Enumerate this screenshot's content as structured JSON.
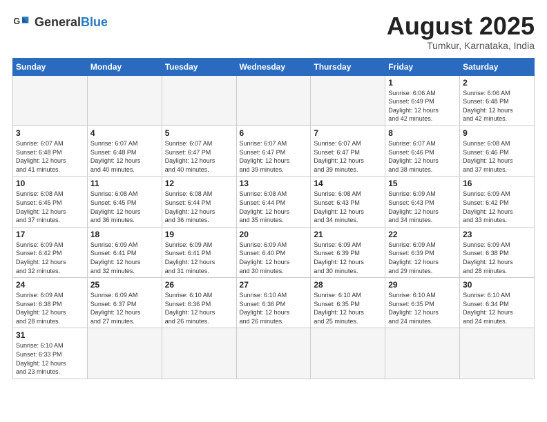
{
  "header": {
    "logo_general": "General",
    "logo_blue": "Blue",
    "title": "August 2025",
    "subtitle": "Tumkur, Karnataka, India"
  },
  "weekdays": [
    "Sunday",
    "Monday",
    "Tuesday",
    "Wednesday",
    "Thursday",
    "Friday",
    "Saturday"
  ],
  "weeks": [
    [
      {
        "day": "",
        "info": "",
        "empty": true
      },
      {
        "day": "",
        "info": "",
        "empty": true
      },
      {
        "day": "",
        "info": "",
        "empty": true
      },
      {
        "day": "",
        "info": "",
        "empty": true
      },
      {
        "day": "",
        "info": "",
        "empty": true
      },
      {
        "day": "1",
        "info": "Sunrise: 6:06 AM\nSunset: 6:49 PM\nDaylight: 12 hours\nand 42 minutes."
      },
      {
        "day": "2",
        "info": "Sunrise: 6:06 AM\nSunset: 6:48 PM\nDaylight: 12 hours\nand 42 minutes."
      }
    ],
    [
      {
        "day": "3",
        "info": "Sunrise: 6:07 AM\nSunset: 6:48 PM\nDaylight: 12 hours\nand 41 minutes."
      },
      {
        "day": "4",
        "info": "Sunrise: 6:07 AM\nSunset: 6:48 PM\nDaylight: 12 hours\nand 40 minutes."
      },
      {
        "day": "5",
        "info": "Sunrise: 6:07 AM\nSunset: 6:47 PM\nDaylight: 12 hours\nand 40 minutes."
      },
      {
        "day": "6",
        "info": "Sunrise: 6:07 AM\nSunset: 6:47 PM\nDaylight: 12 hours\nand 39 minutes."
      },
      {
        "day": "7",
        "info": "Sunrise: 6:07 AM\nSunset: 6:47 PM\nDaylight: 12 hours\nand 39 minutes."
      },
      {
        "day": "8",
        "info": "Sunrise: 6:07 AM\nSunset: 6:46 PM\nDaylight: 12 hours\nand 38 minutes."
      },
      {
        "day": "9",
        "info": "Sunrise: 6:08 AM\nSunset: 6:46 PM\nDaylight: 12 hours\nand 37 minutes."
      }
    ],
    [
      {
        "day": "10",
        "info": "Sunrise: 6:08 AM\nSunset: 6:45 PM\nDaylight: 12 hours\nand 37 minutes."
      },
      {
        "day": "11",
        "info": "Sunrise: 6:08 AM\nSunset: 6:45 PM\nDaylight: 12 hours\nand 36 minutes."
      },
      {
        "day": "12",
        "info": "Sunrise: 6:08 AM\nSunset: 6:44 PM\nDaylight: 12 hours\nand 36 minutes."
      },
      {
        "day": "13",
        "info": "Sunrise: 6:08 AM\nSunset: 6:44 PM\nDaylight: 12 hours\nand 35 minutes."
      },
      {
        "day": "14",
        "info": "Sunrise: 6:08 AM\nSunset: 6:43 PM\nDaylight: 12 hours\nand 34 minutes."
      },
      {
        "day": "15",
        "info": "Sunrise: 6:09 AM\nSunset: 6:43 PM\nDaylight: 12 hours\nand 34 minutes."
      },
      {
        "day": "16",
        "info": "Sunrise: 6:09 AM\nSunset: 6:42 PM\nDaylight: 12 hours\nand 33 minutes."
      }
    ],
    [
      {
        "day": "17",
        "info": "Sunrise: 6:09 AM\nSunset: 6:42 PM\nDaylight: 12 hours\nand 32 minutes."
      },
      {
        "day": "18",
        "info": "Sunrise: 6:09 AM\nSunset: 6:41 PM\nDaylight: 12 hours\nand 32 minutes."
      },
      {
        "day": "19",
        "info": "Sunrise: 6:09 AM\nSunset: 6:41 PM\nDaylight: 12 hours\nand 31 minutes."
      },
      {
        "day": "20",
        "info": "Sunrise: 6:09 AM\nSunset: 6:40 PM\nDaylight: 12 hours\nand 30 minutes."
      },
      {
        "day": "21",
        "info": "Sunrise: 6:09 AM\nSunset: 6:39 PM\nDaylight: 12 hours\nand 30 minutes."
      },
      {
        "day": "22",
        "info": "Sunrise: 6:09 AM\nSunset: 6:39 PM\nDaylight: 12 hours\nand 29 minutes."
      },
      {
        "day": "23",
        "info": "Sunrise: 6:09 AM\nSunset: 6:38 PM\nDaylight: 12 hours\nand 28 minutes."
      }
    ],
    [
      {
        "day": "24",
        "info": "Sunrise: 6:09 AM\nSunset: 6:38 PM\nDaylight: 12 hours\nand 28 minutes."
      },
      {
        "day": "25",
        "info": "Sunrise: 6:09 AM\nSunset: 6:37 PM\nDaylight: 12 hours\nand 27 minutes."
      },
      {
        "day": "26",
        "info": "Sunrise: 6:10 AM\nSunset: 6:36 PM\nDaylight: 12 hours\nand 26 minutes."
      },
      {
        "day": "27",
        "info": "Sunrise: 6:10 AM\nSunset: 6:36 PM\nDaylight: 12 hours\nand 26 minutes."
      },
      {
        "day": "28",
        "info": "Sunrise: 6:10 AM\nSunset: 6:35 PM\nDaylight: 12 hours\nand 25 minutes."
      },
      {
        "day": "29",
        "info": "Sunrise: 6:10 AM\nSunset: 6:35 PM\nDaylight: 12 hours\nand 24 minutes."
      },
      {
        "day": "30",
        "info": "Sunrise: 6:10 AM\nSunset: 6:34 PM\nDaylight: 12 hours\nand 24 minutes."
      }
    ],
    [
      {
        "day": "31",
        "info": "Sunrise: 6:10 AM\nSunset: 6:33 PM\nDaylight: 12 hours\nand 23 minutes."
      },
      {
        "day": "",
        "info": "",
        "empty": true
      },
      {
        "day": "",
        "info": "",
        "empty": true
      },
      {
        "day": "",
        "info": "",
        "empty": true
      },
      {
        "day": "",
        "info": "",
        "empty": true
      },
      {
        "day": "",
        "info": "",
        "empty": true
      },
      {
        "day": "",
        "info": "",
        "empty": true
      }
    ]
  ]
}
